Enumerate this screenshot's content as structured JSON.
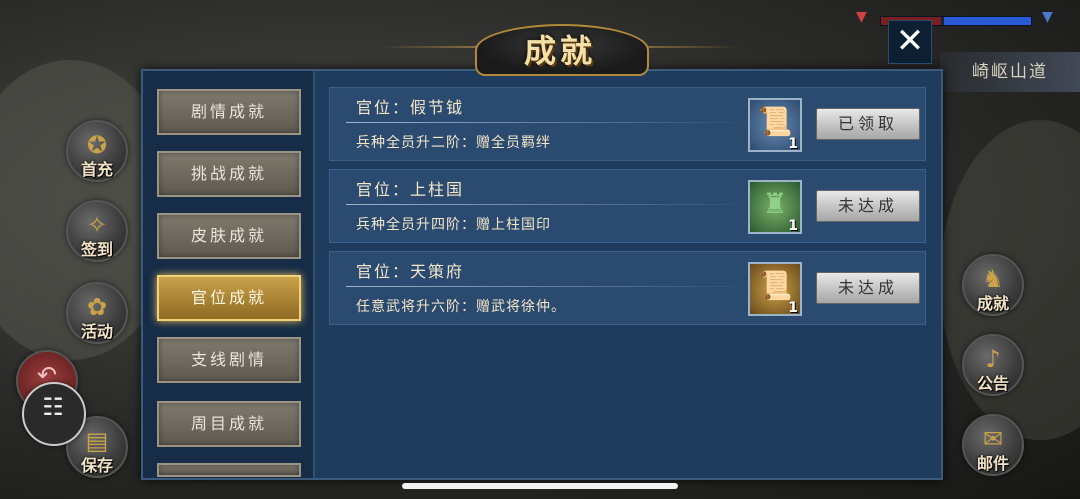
{
  "title": "成就",
  "location": "崎岖山道",
  "close_symbol": "✕",
  "sidebar_left": [
    {
      "label": "首充",
      "icon": "treasure-icon"
    },
    {
      "label": "签到",
      "icon": "checkin-icon"
    },
    {
      "label": "活动",
      "icon": "gift-icon"
    },
    {
      "label": "保存",
      "icon": "scroll-icon"
    }
  ],
  "sidebar_right": [
    {
      "label": "成就",
      "icon": "lion-icon"
    },
    {
      "label": "公告",
      "icon": "horn-icon"
    },
    {
      "label": "邮件",
      "icon": "mail-icon"
    }
  ],
  "menu": [
    {
      "label": "剧情成就",
      "active": false
    },
    {
      "label": "挑战成就",
      "active": false
    },
    {
      "label": "皮肤成就",
      "active": false
    },
    {
      "label": "官位成就",
      "active": true
    },
    {
      "label": "支线剧情",
      "active": false
    },
    {
      "label": "周目成就",
      "active": false
    }
  ],
  "achievements": [
    {
      "rank": "官位：假节钺",
      "desc": "兵种全员升二阶：赠全员羁绊",
      "reward_icon": "blue-scroll-icon",
      "reward_count": "1",
      "button": "已领取"
    },
    {
      "rank": "官位：上柱国",
      "desc": "兵种全员升四阶：赠上柱国印",
      "reward_icon": "jade-seal-icon",
      "reward_count": "1",
      "button": "未达成"
    },
    {
      "rank": "官位：天策府",
      "desc": "任意武将升六阶：赠武将徐仲。",
      "reward_icon": "gold-scroll-icon",
      "reward_count": "1",
      "button": "未达成"
    }
  ],
  "colors": {
    "panel": "#1b3554",
    "active_tab": "#c9a24a",
    "text": "#f3e7c8"
  }
}
